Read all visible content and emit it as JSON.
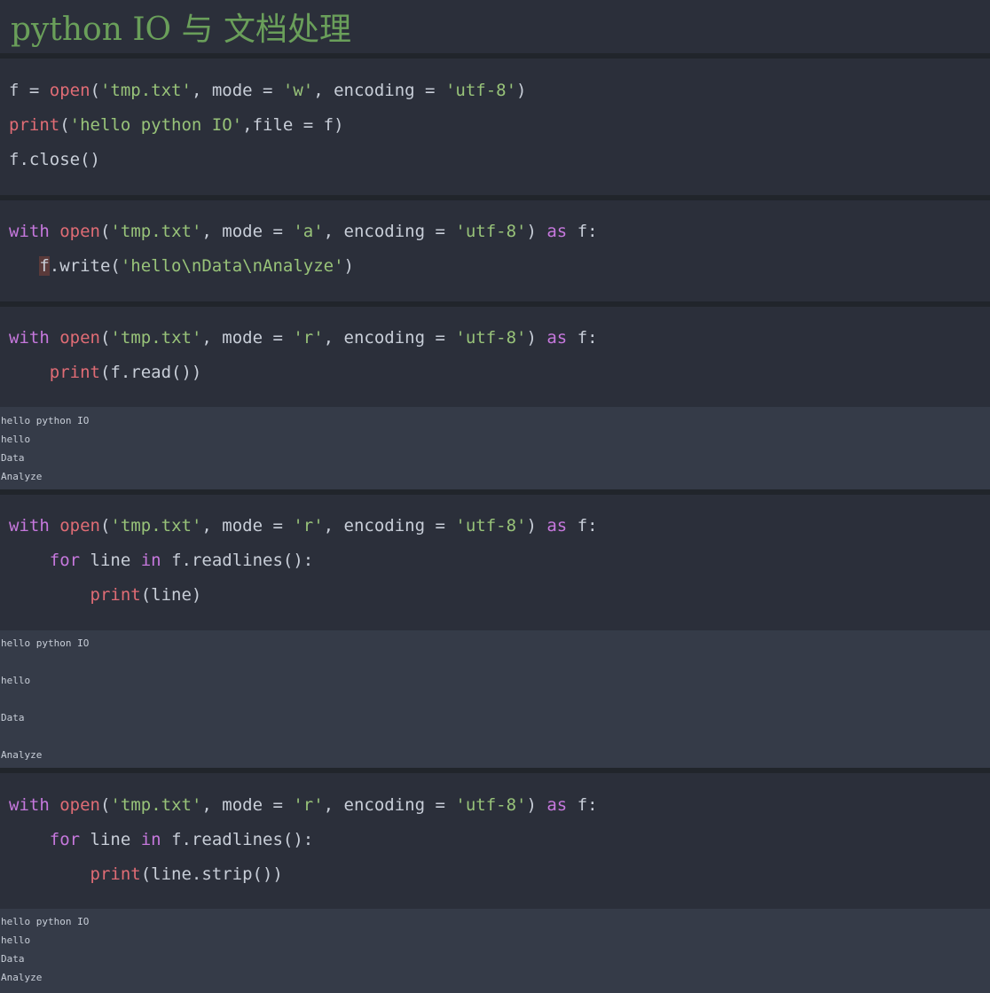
{
  "title": "python IO 与 文档处理",
  "cells": [
    {
      "lines": [
        [
          {
            "t": "f = ",
            "c": "id"
          },
          {
            "t": "open",
            "c": "fn"
          },
          {
            "t": "(",
            "c": "op"
          },
          {
            "t": "'tmp.txt'",
            "c": "str"
          },
          {
            "t": ", mode = ",
            "c": "id"
          },
          {
            "t": "'w'",
            "c": "str"
          },
          {
            "t": ", encoding = ",
            "c": "id"
          },
          {
            "t": "'utf-8'",
            "c": "str"
          },
          {
            "t": ")",
            "c": "op"
          }
        ],
        [
          {
            "t": "print",
            "c": "fn"
          },
          {
            "t": "(",
            "c": "op"
          },
          {
            "t": "'hello python IO'",
            "c": "str"
          },
          {
            "t": ",file = f)",
            "c": "id"
          }
        ],
        [
          {
            "t": "f.close()",
            "c": "id"
          }
        ]
      ]
    },
    {
      "lines": [
        [
          {
            "t": "with",
            "c": "kw"
          },
          {
            "t": " ",
            "c": "id"
          },
          {
            "t": "open",
            "c": "fn"
          },
          {
            "t": "(",
            "c": "op"
          },
          {
            "t": "'tmp.txt'",
            "c": "str"
          },
          {
            "t": ", mode = ",
            "c": "id"
          },
          {
            "t": "'a'",
            "c": "str"
          },
          {
            "t": ", encoding = ",
            "c": "id"
          },
          {
            "t": "'utf-8'",
            "c": "str"
          },
          {
            "t": ") ",
            "c": "op"
          },
          {
            "t": "as",
            "c": "kw"
          },
          {
            "t": " f:",
            "c": "id"
          }
        ],
        [
          {
            "t": "   ",
            "c": "id"
          },
          {
            "t": "f",
            "c": "id ind-mark"
          },
          {
            "t": ".write(",
            "c": "id"
          },
          {
            "t": "'hello\\nData\\nAnalyze'",
            "c": "str"
          },
          {
            "t": ")",
            "c": "op"
          }
        ]
      ]
    },
    {
      "lines": [
        [
          {
            "t": "with",
            "c": "kw"
          },
          {
            "t": " ",
            "c": "id"
          },
          {
            "t": "open",
            "c": "fn"
          },
          {
            "t": "(",
            "c": "op"
          },
          {
            "t": "'tmp.txt'",
            "c": "str"
          },
          {
            "t": ", mode = ",
            "c": "id"
          },
          {
            "t": "'r'",
            "c": "str"
          },
          {
            "t": ", encoding = ",
            "c": "id"
          },
          {
            "t": "'utf-8'",
            "c": "str"
          },
          {
            "t": ") ",
            "c": "op"
          },
          {
            "t": "as",
            "c": "kw"
          },
          {
            "t": " f:",
            "c": "id"
          }
        ],
        [
          {
            "t": "    ",
            "c": "id"
          },
          {
            "t": "print",
            "c": "fn"
          },
          {
            "t": "(f.read())",
            "c": "id"
          }
        ]
      ],
      "output": [
        "hello python IO",
        "hello",
        "Data",
        "Analyze"
      ]
    },
    {
      "lines": [
        [
          {
            "t": "with",
            "c": "kw"
          },
          {
            "t": " ",
            "c": "id"
          },
          {
            "t": "open",
            "c": "fn"
          },
          {
            "t": "(",
            "c": "op"
          },
          {
            "t": "'tmp.txt'",
            "c": "str"
          },
          {
            "t": ", mode = ",
            "c": "id"
          },
          {
            "t": "'r'",
            "c": "str"
          },
          {
            "t": ", encoding = ",
            "c": "id"
          },
          {
            "t": "'utf-8'",
            "c": "str"
          },
          {
            "t": ") ",
            "c": "op"
          },
          {
            "t": "as",
            "c": "kw"
          },
          {
            "t": " f:",
            "c": "id"
          }
        ],
        [
          {
            "t": "    ",
            "c": "id"
          },
          {
            "t": "for",
            "c": "kw"
          },
          {
            "t": " line ",
            "c": "id"
          },
          {
            "t": "in",
            "c": "kw"
          },
          {
            "t": " f.readlines():",
            "c": "id"
          }
        ],
        [
          {
            "t": "        ",
            "c": "id"
          },
          {
            "t": "print",
            "c": "fn"
          },
          {
            "t": "(line)",
            "c": "id"
          }
        ]
      ],
      "output": [
        "hello python IO",
        "",
        "hello",
        "",
        "Data",
        "",
        "Analyze"
      ]
    },
    {
      "lines": [
        [
          {
            "t": "with",
            "c": "kw"
          },
          {
            "t": " ",
            "c": "id"
          },
          {
            "t": "open",
            "c": "fn"
          },
          {
            "t": "(",
            "c": "op"
          },
          {
            "t": "'tmp.txt'",
            "c": "str"
          },
          {
            "t": ", mode = ",
            "c": "id"
          },
          {
            "t": "'r'",
            "c": "str"
          },
          {
            "t": ", encoding = ",
            "c": "id"
          },
          {
            "t": "'utf-8'",
            "c": "str"
          },
          {
            "t": ") ",
            "c": "op"
          },
          {
            "t": "as",
            "c": "kw"
          },
          {
            "t": " f:",
            "c": "id"
          }
        ],
        [
          {
            "t": "    ",
            "c": "id"
          },
          {
            "t": "for",
            "c": "kw"
          },
          {
            "t": " line ",
            "c": "id"
          },
          {
            "t": "in",
            "c": "kw"
          },
          {
            "t": " f.readlines():",
            "c": "id"
          }
        ],
        [
          {
            "t": "        ",
            "c": "id"
          },
          {
            "t": "print",
            "c": "fn"
          },
          {
            "t": "(line.strip())",
            "c": "id"
          }
        ]
      ],
      "output": [
        "hello python IO",
        "hello",
        "Data",
        "Analyze"
      ]
    }
  ]
}
